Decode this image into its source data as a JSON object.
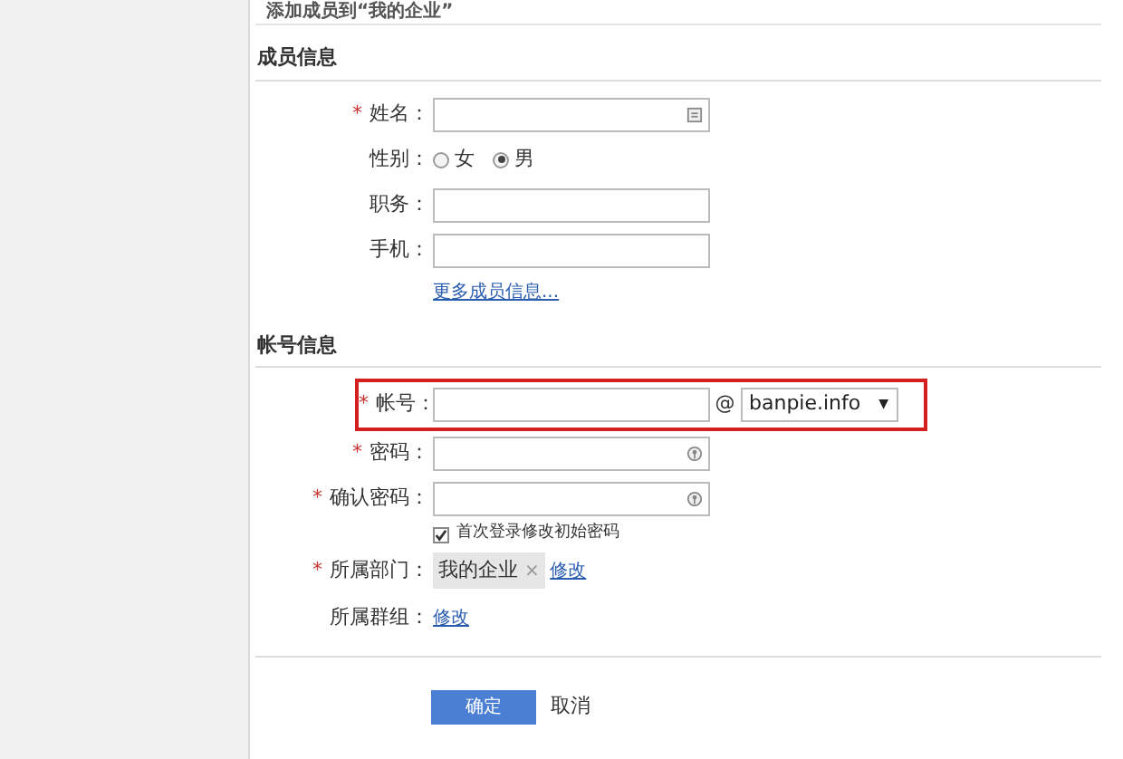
{
  "page_title": "添加成员到“我的企业”",
  "sections": [
    {
      "title": "成员信息",
      "fields": [
        {
          "kind": "contact",
          "label": "姓名：",
          "required_mark": "*"
        },
        {
          "kind": "radio",
          "label": "性别：",
          "options": [
            {
              "label": "女",
              "selected": false
            },
            {
              "label": "男",
              "selected": true
            }
          ]
        },
        {
          "kind": "text",
          "label": "职务："
        },
        {
          "kind": "text",
          "label": "手机："
        },
        {
          "kind": "link",
          "text": "更多成员信息..."
        }
      ]
    },
    {
      "title": "帐号信息",
      "fields": [
        {
          "kind": "account",
          "label": "帐号：",
          "required_mark": "*",
          "highlighted": true,
          "at": "@",
          "domain": "banpie.info",
          "caret": "▼"
        },
        {
          "kind": "password",
          "label": "密码：",
          "required_mark": "*"
        },
        {
          "kind": "password",
          "label": "确认密码：",
          "required_mark": "*"
        },
        {
          "kind": "checkbox",
          "text": "首次登录修改初始密码",
          "checked": true
        },
        {
          "kind": "tag",
          "label": "所属部门：",
          "required_mark": "*",
          "tag": "我的企业",
          "remove": "×",
          "action": "修改"
        },
        {
          "kind": "action",
          "label": "所属群组：",
          "action": "修改"
        }
      ]
    }
  ],
  "buttons": {
    "submit": "确定",
    "cancel": "取消"
  }
}
